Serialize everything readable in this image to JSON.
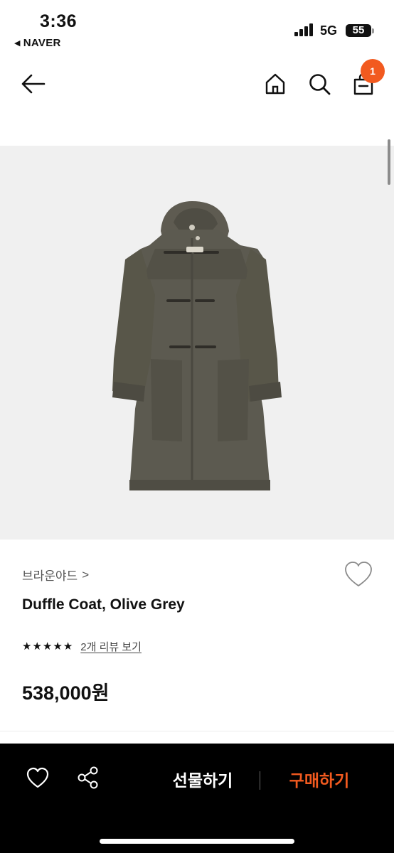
{
  "status_bar": {
    "time": "3:36",
    "back_app": "NAVER",
    "network": "5G",
    "battery": "55"
  },
  "nav": {
    "cart_count": "1",
    "icons": [
      "back-arrow-icon",
      "home-icon",
      "search-icon",
      "shopping-bag-icon"
    ]
  },
  "product": {
    "brand": "브라운야드",
    "brand_chevron": ">",
    "name": "Duffle Coat, Olive Grey",
    "rating_stars": 5,
    "review_link": "2개 리뷰 보기",
    "price": "538,000원",
    "image_icon": "olive-duffle-coat-image"
  },
  "bottom_bar": {
    "gift_label": "선물하기",
    "buy_label": "구매하기",
    "icons": [
      "heart-icon",
      "share-icon"
    ]
  },
  "colors": {
    "accent": "#f25a1f",
    "coat": "#5c5a50",
    "image_bg": "#f0f0f0",
    "bottom_bar_bg": "#000000"
  }
}
